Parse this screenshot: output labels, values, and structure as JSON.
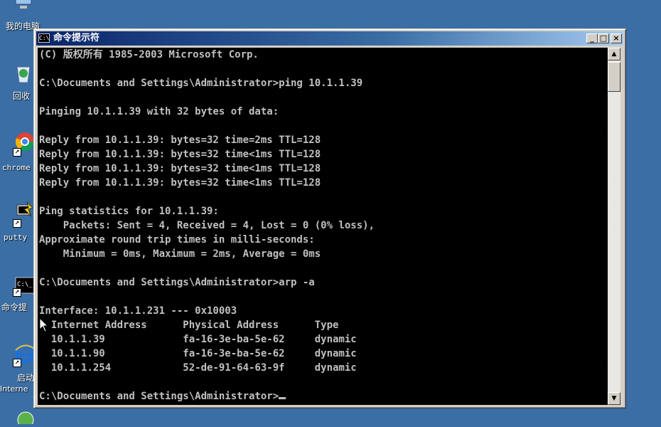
{
  "desktop": {
    "icons": [
      {
        "label": "我的电脑",
        "icon": "computer-icon"
      },
      {
        "label": "回收",
        "icon": "recycle-bin-icon"
      },
      {
        "label": "chrome",
        "icon": "chrome-icon"
      },
      {
        "label": "putty",
        "icon": "putty-icon"
      },
      {
        "label": "命令提",
        "icon": "cmd-icon"
      },
      {
        "label": "启动",
        "label2": "Interne",
        "icon": "ie-icon"
      }
    ]
  },
  "window": {
    "title": "命令提示符",
    "icon": "cmd-icon",
    "buttons": {
      "minimize": "_",
      "maximize": "□",
      "close": "×"
    }
  },
  "console": {
    "lines": [
      "(C) 版权所有 1985-2003 Microsoft Corp.",
      "",
      "C:\\Documents and Settings\\Administrator>ping 10.1.1.39",
      "",
      "Pinging 10.1.1.39 with 32 bytes of data:",
      "",
      "Reply from 10.1.1.39: bytes=32 time=2ms TTL=128",
      "Reply from 10.1.1.39: bytes=32 time<1ms TTL=128",
      "Reply from 10.1.1.39: bytes=32 time<1ms TTL=128",
      "Reply from 10.1.1.39: bytes=32 time<1ms TTL=128",
      "",
      "Ping statistics for 10.1.1.39:",
      "    Packets: Sent = 4, Received = 4, Lost = 0 (0% loss),",
      "Approximate round trip times in milli-seconds:",
      "    Minimum = 0ms, Maximum = 2ms, Average = 0ms",
      "",
      "C:\\Documents and Settings\\Administrator>arp -a",
      "",
      "Interface: 10.1.1.231 --- 0x10003",
      "  Internet Address      Physical Address      Type",
      "  10.1.1.39             fa-16-3e-ba-5e-62     dynamic",
      "  10.1.1.90             fa-16-3e-ba-5e-62     dynamic",
      "  10.1.1.254            52-de-91-64-63-9f     dynamic",
      "",
      "C:\\Documents and Settings\\Administrator>"
    ]
  }
}
